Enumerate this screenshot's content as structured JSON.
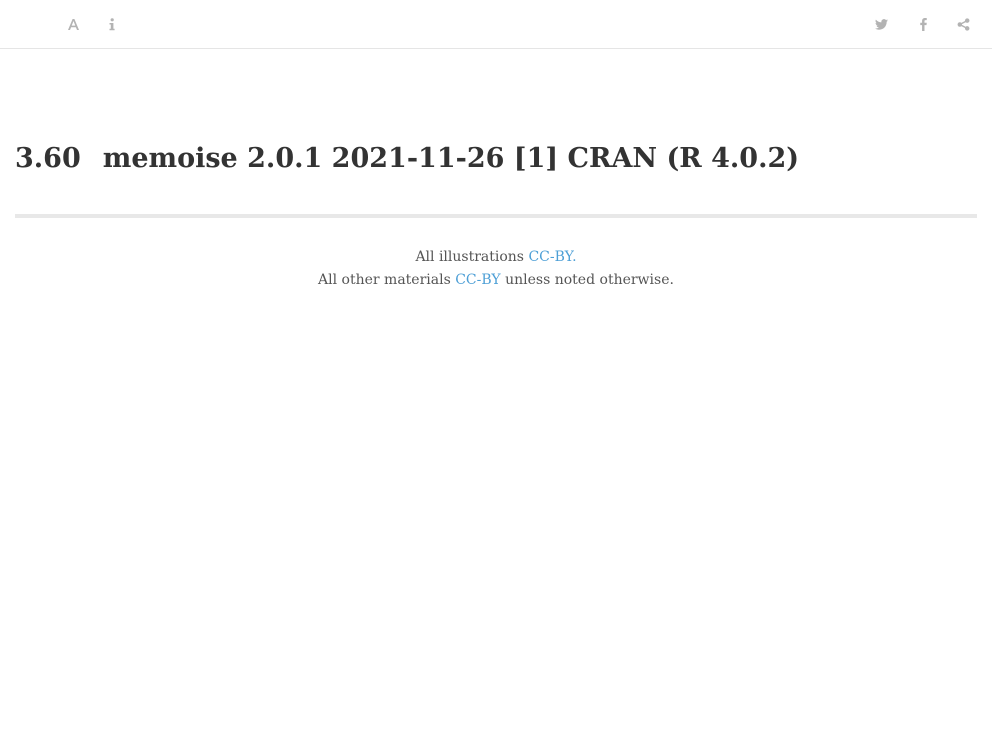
{
  "toolbar": {
    "left_buttons": [
      {
        "icon": "font-icon",
        "label": "Font settings"
      },
      {
        "icon": "info-icon",
        "label": "Information"
      }
    ],
    "right_buttons": [
      {
        "icon": "twitter-icon",
        "label": "Twitter"
      },
      {
        "icon": "facebook-icon",
        "label": "Facebook"
      },
      {
        "icon": "share-icon",
        "label": "Share"
      }
    ],
    "icon_color": "#b3b3b3"
  },
  "main": {
    "section_number": "3.60",
    "title": "memoise 2.0.1 2021-11-26 [1] CRAN (R 4.0.2)"
  },
  "footer": {
    "line1_prefix": "All illustrations",
    "line1_link": "CC-BY.",
    "line2_prefix": "All other materials",
    "line2_link": "CC-BY",
    "line2_suffix": "unless noted otherwise.",
    "link_color": "#4d9fd6"
  }
}
